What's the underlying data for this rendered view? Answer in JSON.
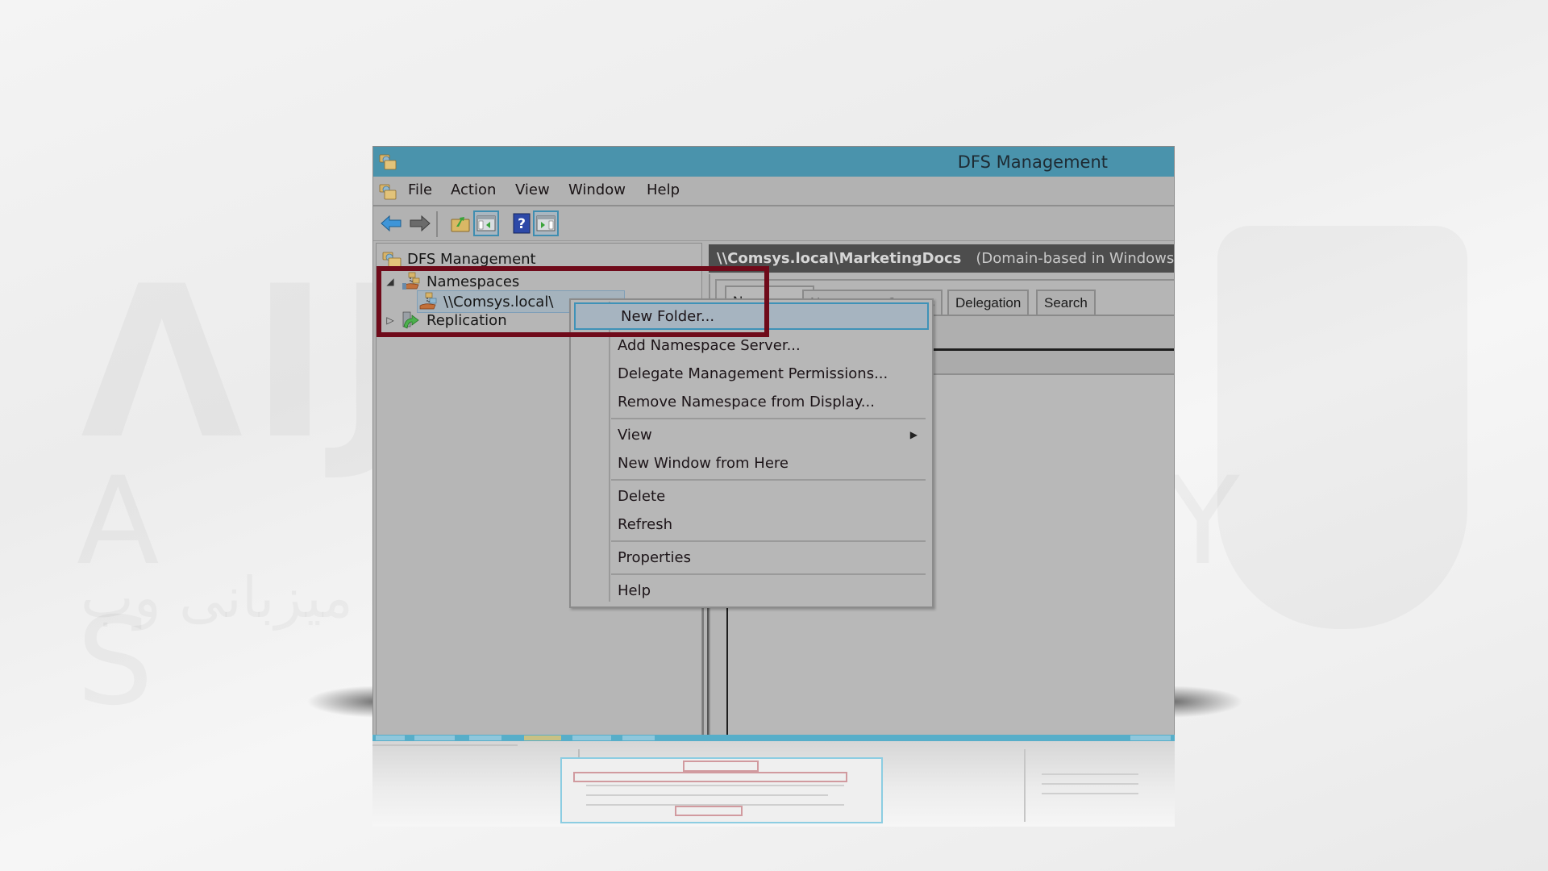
{
  "window": {
    "title": "DFS Management",
    "titlebar_color": "#4a93ac",
    "app_icon": "dfs-management-icon"
  },
  "menubar": {
    "items": [
      "File",
      "Action",
      "View",
      "Window",
      "Help"
    ]
  },
  "toolbar": {
    "buttons": [
      {
        "name": "back",
        "icon": "back-arrow-icon"
      },
      {
        "name": "forward",
        "icon": "forward-arrow-icon"
      },
      {
        "name": "up-one-level",
        "icon": "folder-up-icon"
      },
      {
        "name": "show-hide-console-tree",
        "icon": "console-tree-icon"
      },
      {
        "name": "help",
        "icon": "help-icon"
      },
      {
        "name": "show-hide-action-pane",
        "icon": "action-pane-icon"
      }
    ]
  },
  "tree": {
    "root": "DFS Management",
    "items": [
      {
        "label": "Namespaces",
        "expanded": true,
        "expander": "◢"
      },
      {
        "label": "\\\\Comsys.local\\MarketingDocs",
        "visible_label": "\\\\Comsys.local\\",
        "selected": true
      },
      {
        "label": "Replication",
        "expanded": false,
        "expander": "▷"
      }
    ]
  },
  "detail": {
    "path": "\\\\Comsys.local\\MarketingDocs",
    "type_note": "(Domain-based in Windows Serve",
    "tabs": [
      "Namespace",
      "Namespace Servers",
      "Delegation",
      "Search"
    ],
    "active_tab": "Namespace"
  },
  "context_menu": {
    "groups": [
      [
        "New Folder...",
        "Add Namespace Server...",
        "Delegate Management Permissions...",
        "Remove Namespace from Display..."
      ],
      [
        "View",
        "New Window from Here"
      ],
      [
        "Delete",
        "Refresh"
      ],
      [
        "Properties"
      ],
      [
        "Help"
      ]
    ],
    "highlighted": "New Folder...",
    "submenu_items": [
      "View"
    ]
  },
  "annotation": {
    "highlight_color": "#6f0a1a"
  },
  "watermark": {
    "brand": "AZAYSYS",
    "letters": "A Z A Y S Y S",
    "arabic": "سرعت بی نهایت میزبانی وب"
  }
}
